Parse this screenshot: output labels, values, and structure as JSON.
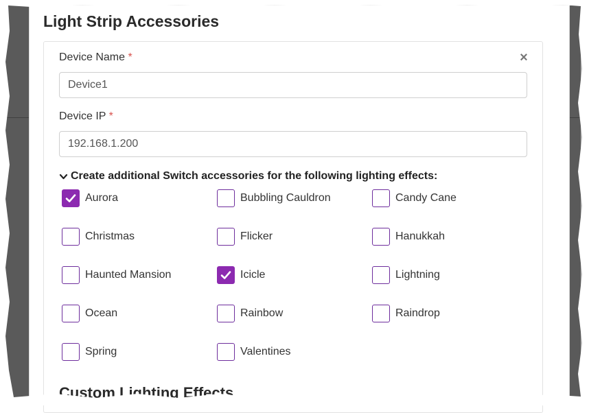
{
  "panel": {
    "title": "Light Strip Accessories"
  },
  "device_name": {
    "label": "Device Name",
    "required_mark": "*",
    "value": "Device1"
  },
  "device_ip": {
    "label": "Device IP",
    "required_mark": "*",
    "value": "192.168.1.200"
  },
  "effects": {
    "heading": "Create additional Switch accessories for the following lighting effects:",
    "options": [
      {
        "label": "Aurora",
        "checked": true
      },
      {
        "label": "Bubbling Cauldron",
        "checked": false
      },
      {
        "label": "Candy Cane",
        "checked": false
      },
      {
        "label": "Christmas",
        "checked": false
      },
      {
        "label": "Flicker",
        "checked": false
      },
      {
        "label": "Hanukkah",
        "checked": false
      },
      {
        "label": "Haunted Mansion",
        "checked": false
      },
      {
        "label": "Icicle",
        "checked": true
      },
      {
        "label": "Lightning",
        "checked": false
      },
      {
        "label": "Ocean",
        "checked": false
      },
      {
        "label": "Rainbow",
        "checked": false
      },
      {
        "label": "Raindrop",
        "checked": false
      },
      {
        "label": "Spring",
        "checked": false
      },
      {
        "label": "Valentines",
        "checked": false
      }
    ]
  },
  "custom_section": {
    "title": "Custom Lighting Effects"
  },
  "icons": {
    "close": "close-icon",
    "toggle": "chevron-down-icon",
    "check": "check-icon"
  },
  "colors": {
    "checkbox_accent": "#8c2ab0",
    "required": "#d9534f"
  }
}
